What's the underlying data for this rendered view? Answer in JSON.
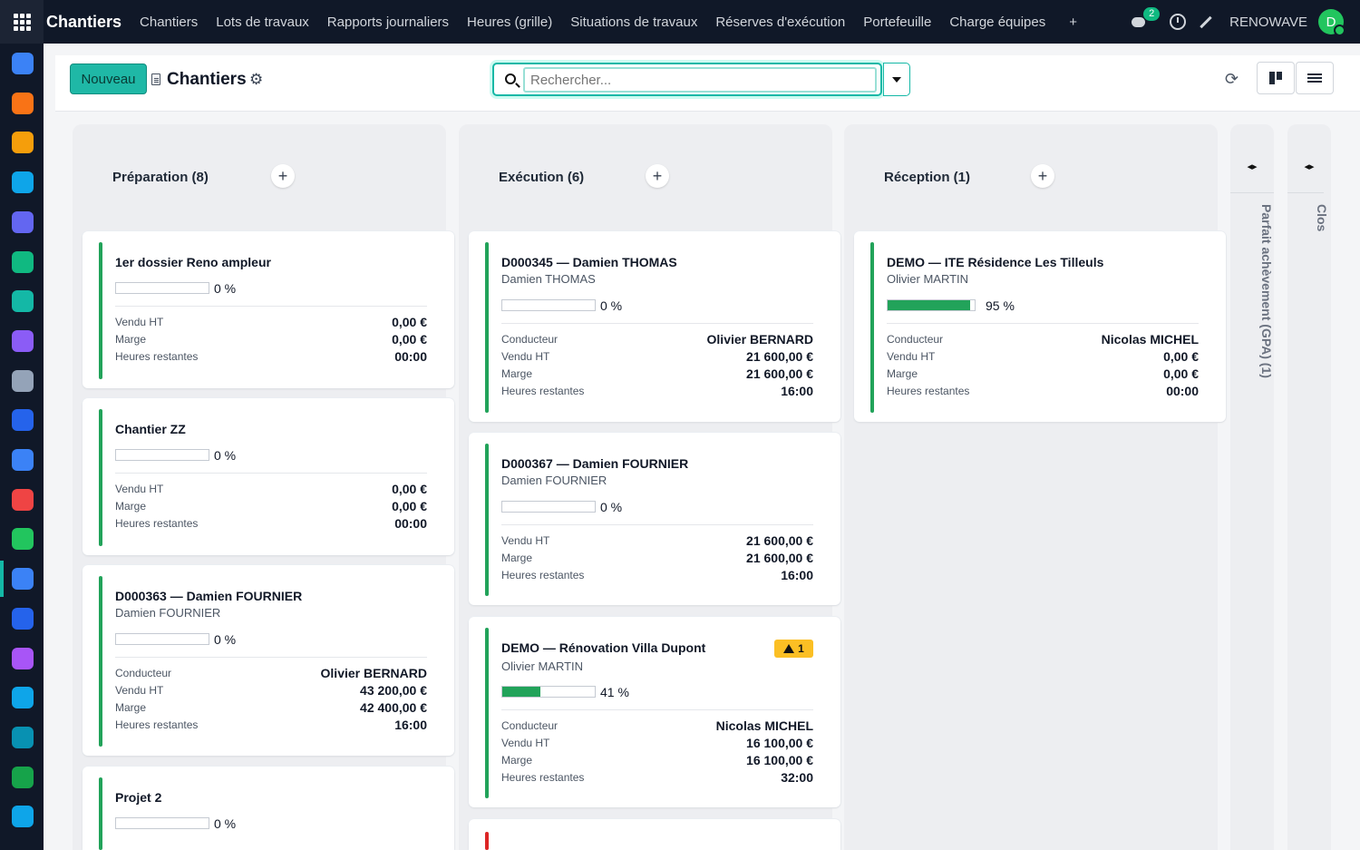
{
  "topbar": {
    "brand": "Chantiers",
    "menu": [
      "Chantiers",
      "Lots de travaux",
      "Rapports journaliers",
      "Heures (grille)",
      "Situations de travaux",
      "Réserves d'exécution",
      "Portefeuille",
      "Charge équipes"
    ],
    "plus": "+",
    "messages_count": "2",
    "company": "RENOWAVE",
    "avatar_initial": "D"
  },
  "sidebar": {
    "icons": [
      "discuss-icon",
      "chat-bubble-icon",
      "calendar-31-icon",
      "sign-icon",
      "crm-icon",
      "contacts-icon",
      "mail-icon",
      "sales-icon",
      "accounting-icon",
      "project-icon",
      "planning-icon",
      "dashboard-icon",
      "timesheet-icon",
      "chantiers-icon",
      "documents-icon",
      "purchase-icon",
      "invoicing-icon",
      "employees-icon",
      "spreadsheet-icon",
      "tools-icon"
    ],
    "colors": [
      "#3b82f6",
      "#f97316",
      "#f59e0b",
      "#0ea5e9",
      "#6366f1",
      "#10b981",
      "#14b8a6",
      "#8b5cf6",
      "#94a3b8",
      "#2563eb",
      "#3b82f6",
      "#ef4444",
      "#22c55e",
      "#3b82f6",
      "#2563eb",
      "#a855f7",
      "#0ea5e9",
      "#0891b2",
      "#16a34a",
      "#0ea5e9"
    ]
  },
  "control": {
    "new_label": "Nouveau",
    "title": "Chantiers",
    "gear": "⚙",
    "search_placeholder": "Rechercher...",
    "refresh": "⟳"
  },
  "columns": [
    {
      "title": "Préparation (8)",
      "cards": [
        {
          "title": "1er dossier Reno ampleur",
          "progress": "0 %",
          "progress_value": 0,
          "rows": [
            {
              "label": "Vendu HT",
              "value": "0,00 €"
            },
            {
              "label": "Marge",
              "value": "0,00 €"
            },
            {
              "label": "Heures restantes",
              "value": "00:00"
            }
          ]
        },
        {
          "title": "Chantier ZZ",
          "progress": "0 %",
          "progress_value": 0,
          "rows": [
            {
              "label": "Vendu HT",
              "value": "0,00 €"
            },
            {
              "label": "Marge",
              "value": "0,00 €"
            },
            {
              "label": "Heures restantes",
              "value": "00:00"
            }
          ]
        },
        {
          "title": "D000363 — Damien FOURNIER",
          "subtitle": "Damien FOURNIER",
          "progress": "0 %",
          "progress_value": 0,
          "rows": [
            {
              "label": "Conducteur",
              "value": "Olivier BERNARD"
            },
            {
              "label": "Vendu HT",
              "value": "43 200,00 €"
            },
            {
              "label": "Marge",
              "value": "42 400,00 €"
            },
            {
              "label": "Heures restantes",
              "value": "16:00"
            }
          ]
        },
        {
          "title": "Projet 2",
          "progress": "0 %",
          "progress_value": 0
        }
      ]
    },
    {
      "title": "Exécution (6)",
      "cards": [
        {
          "title": "D000345 — Damien THOMAS",
          "subtitle": "Damien THOMAS",
          "progress": "0 %",
          "progress_value": 0,
          "rows": [
            {
              "label": "Conducteur",
              "value": "Olivier BERNARD"
            },
            {
              "label": "Vendu HT",
              "value": "21 600,00 €"
            },
            {
              "label": "Marge",
              "value": "21 600,00 €"
            },
            {
              "label": "Heures restantes",
              "value": "16:00"
            }
          ]
        },
        {
          "title": "D000367 — Damien FOURNIER",
          "subtitle": "Damien FOURNIER",
          "progress": "0 %",
          "progress_value": 0,
          "rows": [
            {
              "label": "Vendu HT",
              "value": "21 600,00 €"
            },
            {
              "label": "Marge",
              "value": "21 600,00 €"
            },
            {
              "label": "Heures restantes",
              "value": "16:00"
            }
          ]
        },
        {
          "title": "DEMO — Rénovation Villa Dupont",
          "subtitle": "Olivier MARTIN",
          "warning": "1",
          "progress": "41 %",
          "progress_value": 41,
          "rows": [
            {
              "label": "Conducteur",
              "value": "Nicolas MICHEL"
            },
            {
              "label": "Vendu HT",
              "value": "16 100,00 €"
            },
            {
              "label": "Marge",
              "value": "16 100,00 €"
            },
            {
              "label": "Heures restantes",
              "value": "32:00"
            }
          ]
        }
      ]
    },
    {
      "title": "Réception (1)",
      "cards": [
        {
          "title": "DEMO — ITE Résidence Les Tilleuls",
          "subtitle": "Olivier MARTIN",
          "progress": "95 %",
          "progress_value": 95,
          "rows": [
            {
              "label": "Conducteur",
              "value": "Nicolas MICHEL"
            },
            {
              "label": "Vendu HT",
              "value": "0,00 €"
            },
            {
              "label": "Marge",
              "value": "0,00 €"
            },
            {
              "label": "Heures restantes",
              "value": "00:00"
            }
          ]
        }
      ]
    }
  ],
  "folded": [
    {
      "title": "Parfait achèvement (GPA) (1)"
    },
    {
      "title": "Clos"
    }
  ]
}
